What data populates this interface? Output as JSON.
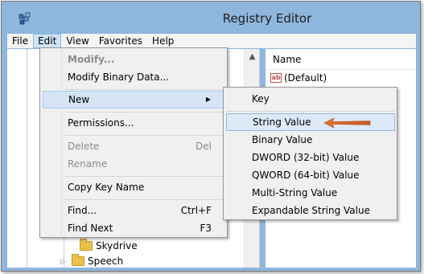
{
  "window": {
    "title": "Registry Editor"
  },
  "menubar": {
    "items": [
      "File",
      "Edit",
      "View",
      "Favorites",
      "Help"
    ],
    "active": "Edit"
  },
  "edit_menu": {
    "modify": "Modify...",
    "modify_binary": "Modify Binary Data...",
    "new": "New",
    "permissions": "Permissions...",
    "delete": "Delete",
    "delete_shortcut": "Del",
    "rename": "Rename",
    "copy_key_name": "Copy Key Name",
    "find": "Find...",
    "find_shortcut": "Ctrl+F",
    "find_next": "Find Next",
    "find_next_shortcut": "F3"
  },
  "new_submenu": {
    "key": "Key",
    "string_value": "String Value",
    "binary_value": "Binary Value",
    "dword_value": "DWORD (32-bit) Value",
    "qword_value": "QWORD (64-bit) Value",
    "multi_string_value": "Multi-String Value",
    "expandable_string_value": "Expandable String Value"
  },
  "tree": {
    "nodes": [
      "Skydrive",
      "Speech"
    ]
  },
  "values_pane": {
    "column_name": "Name",
    "rows": [
      "(Default)"
    ]
  },
  "colors": {
    "titlebar": "#8fb6dc",
    "highlight": "#d5e4f4",
    "arrow": "#d9662c"
  },
  "icons": {
    "app": "registry-icon",
    "value": "string-value-icon",
    "folder": "folder-icon"
  }
}
